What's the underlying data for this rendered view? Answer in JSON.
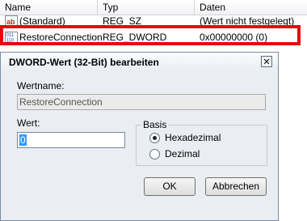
{
  "columns": {
    "name": "Name",
    "type": "Typ",
    "data": "Daten"
  },
  "rows": [
    {
      "name": "(Standard)",
      "type": "REG_SZ",
      "data": "(Wert nicht festgelegt)",
      "icon": "string-value-icon"
    },
    {
      "name": "RestoreConnection",
      "type": "REG_DWORD",
      "data": "0x00000000 (0)",
      "icon": "dword-value-icon"
    }
  ],
  "dialog": {
    "title": "DWORD-Wert (32-Bit) bearbeiten",
    "close_glyph": "✕",
    "name_label": "Wertname:",
    "name_value": "RestoreConnection",
    "value_label": "Wert:",
    "value_value": "0",
    "base_label": "Basis",
    "hex_label": "Hexadezimal",
    "dec_label": "Dezimal",
    "selected_base": "Hexadezimal",
    "ok_label": "OK",
    "cancel_label": "Abbrechen"
  },
  "colors": {
    "highlight": "#e8080c",
    "selection": "#3399ff"
  }
}
